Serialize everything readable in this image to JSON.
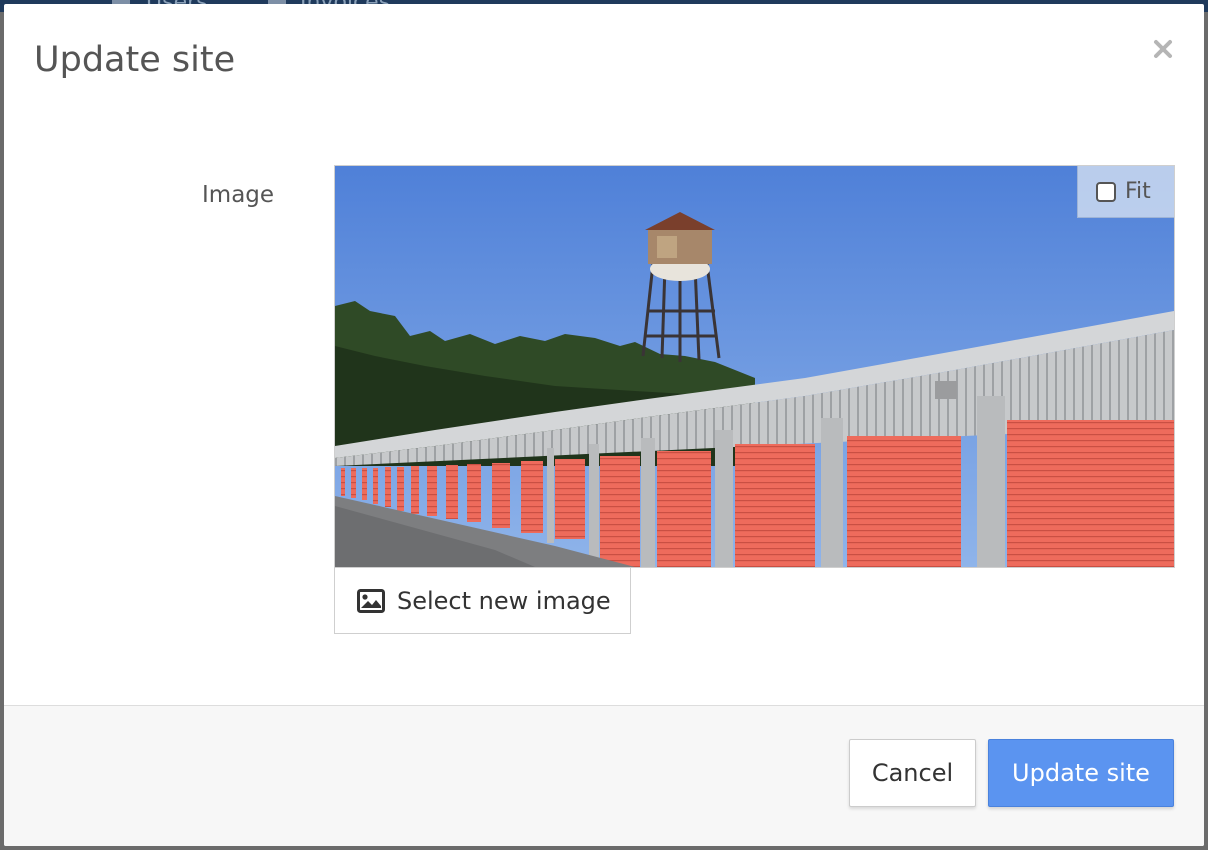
{
  "backdrop": {
    "nav_items": [
      "Users",
      "Invoices"
    ]
  },
  "modal": {
    "title": "Update site",
    "close_icon": "close-icon"
  },
  "form": {
    "image_label": "Image",
    "image": {
      "description_icon": "photo",
      "fit_label": "Fit",
      "fit_checked": false
    },
    "select_image_label": "Select new image",
    "select_image_icon": "image-icon"
  },
  "footer": {
    "cancel_label": "Cancel",
    "submit_label": "Update site"
  },
  "colors": {
    "primary": "#5b94f0",
    "overlay": "#6b6b6b",
    "text": "#555555"
  }
}
